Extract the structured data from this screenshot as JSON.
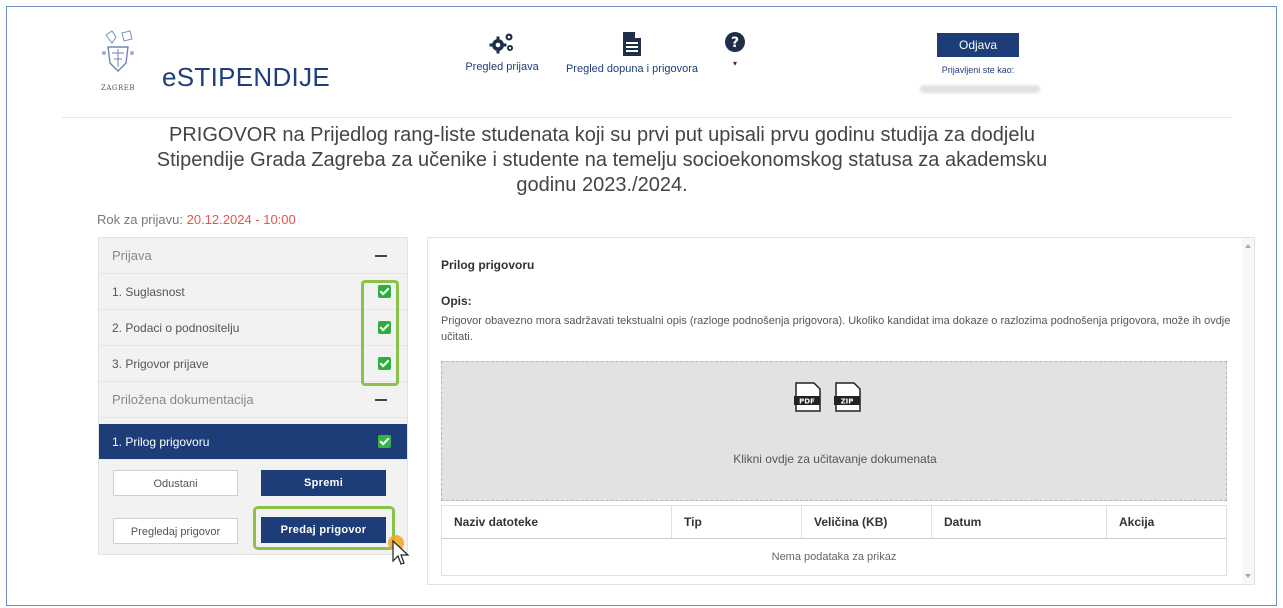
{
  "header": {
    "app_name": "eSTIPENDIJE",
    "logo_text": "ZAGREB",
    "nav": [
      {
        "label": "Pregled prijava",
        "icon": "gears-icon"
      },
      {
        "label": "Pregled dopuna i prigovora",
        "icon": "document-icon"
      },
      {
        "label": "▾",
        "icon": "help-icon"
      }
    ],
    "logout_label": "Odjava",
    "logged_as_label": "Prijavljeni ste kao:"
  },
  "page": {
    "title_line1": "PRIGOVOR na Prijedlog rang-liste studenata koji su prvi put upisali prvu godinu studija za dodjelu",
    "title_line2": "Stipendije Grada Zagreba za učenike i studente na temelju socioekonomskog statusa za akademsku",
    "title_line3": "godinu 2023./2024.",
    "deadline_label": "Rok za prijavu:",
    "deadline_value": "20.12.2024 - 10:00"
  },
  "sidebar": {
    "sections": [
      {
        "label": "Prijava",
        "items": [
          {
            "label": "1. Suglasnost",
            "checked": true
          },
          {
            "label": "2. Podaci o podnositelju",
            "checked": true
          },
          {
            "label": "3. Prigovor prijave",
            "checked": true
          }
        ]
      },
      {
        "label": "Priložena dokumentacija",
        "items": [
          {
            "label": "1. Prilog prigovoru",
            "checked": true,
            "active": true
          }
        ]
      }
    ],
    "buttons": {
      "cancel": "Odustani",
      "save": "Spremi",
      "preview": "Pregledaj prigovor",
      "submit": "Predaj prigovor"
    }
  },
  "panel": {
    "title": "Prilog prigovoru",
    "desc_label": "Opis:",
    "desc_text": "Prigovor obavezno mora sadržavati tekstualni opis (razloge podnošenja prigovora). Ukoliko kandidat ima dokaze o razlozima podnošenja prigovora, može ih ovdje učitati.",
    "file_types": [
      "PDF",
      "ZIP"
    ],
    "dropzone_text": "Klikni ovdje za učitavanje dokumenata",
    "table": {
      "columns": [
        "Naziv datoteke",
        "Tip",
        "Veličina (KB)",
        "Datum",
        "Akcija"
      ],
      "empty_text": "Nema podataka za prikaz"
    }
  },
  "colors": {
    "brand": "#1c3d78",
    "highlight": "#8bc34a",
    "check": "#2fae3b",
    "deadline": "#e8534a"
  }
}
